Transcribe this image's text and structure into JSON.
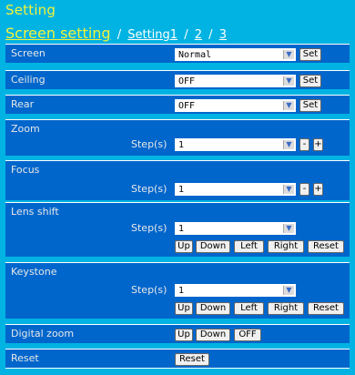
{
  "title": "Setting",
  "nav": {
    "current": "Screen setting",
    "sep": "/",
    "link1": "Setting1",
    "link2": "2",
    "link3": "3"
  },
  "rows": {
    "screen": {
      "label": "Screen",
      "value": "Normal",
      "set": "Set"
    },
    "ceiling": {
      "label": "Ceiling",
      "value": "OFF",
      "set": "Set"
    },
    "rear": {
      "label": "Rear",
      "value": "OFF",
      "set": "Set"
    },
    "zoom": {
      "label": "Zoom",
      "step_label": "Step(s)",
      "value": "1",
      "minus": "-",
      "plus": "+"
    },
    "focus": {
      "label": "Focus",
      "step_label": "Step(s)",
      "value": "1",
      "minus": "-",
      "plus": "+"
    },
    "lens_shift": {
      "label": "Lens shift",
      "step_label": "Step(s)",
      "value": "1",
      "up": "Up",
      "down": "Down",
      "left": "Left",
      "right": "Right",
      "reset": "Reset"
    },
    "keystone": {
      "label": "Keystone",
      "step_label": "Step(s)",
      "value": "1",
      "up": "Up",
      "down": "Down",
      "left": "Left",
      "right": "Right",
      "reset": "Reset"
    },
    "digital_zoom": {
      "label": "Digital zoom",
      "up": "Up",
      "down": "Down",
      "off": "OFF"
    },
    "reset": {
      "label": "Reset",
      "button": "Reset"
    }
  },
  "colors": {
    "background": "#00b3e2",
    "row": "#0066cc",
    "title": "#f2f23a"
  },
  "icons": {
    "dropdown": "chevron-down-icon"
  }
}
